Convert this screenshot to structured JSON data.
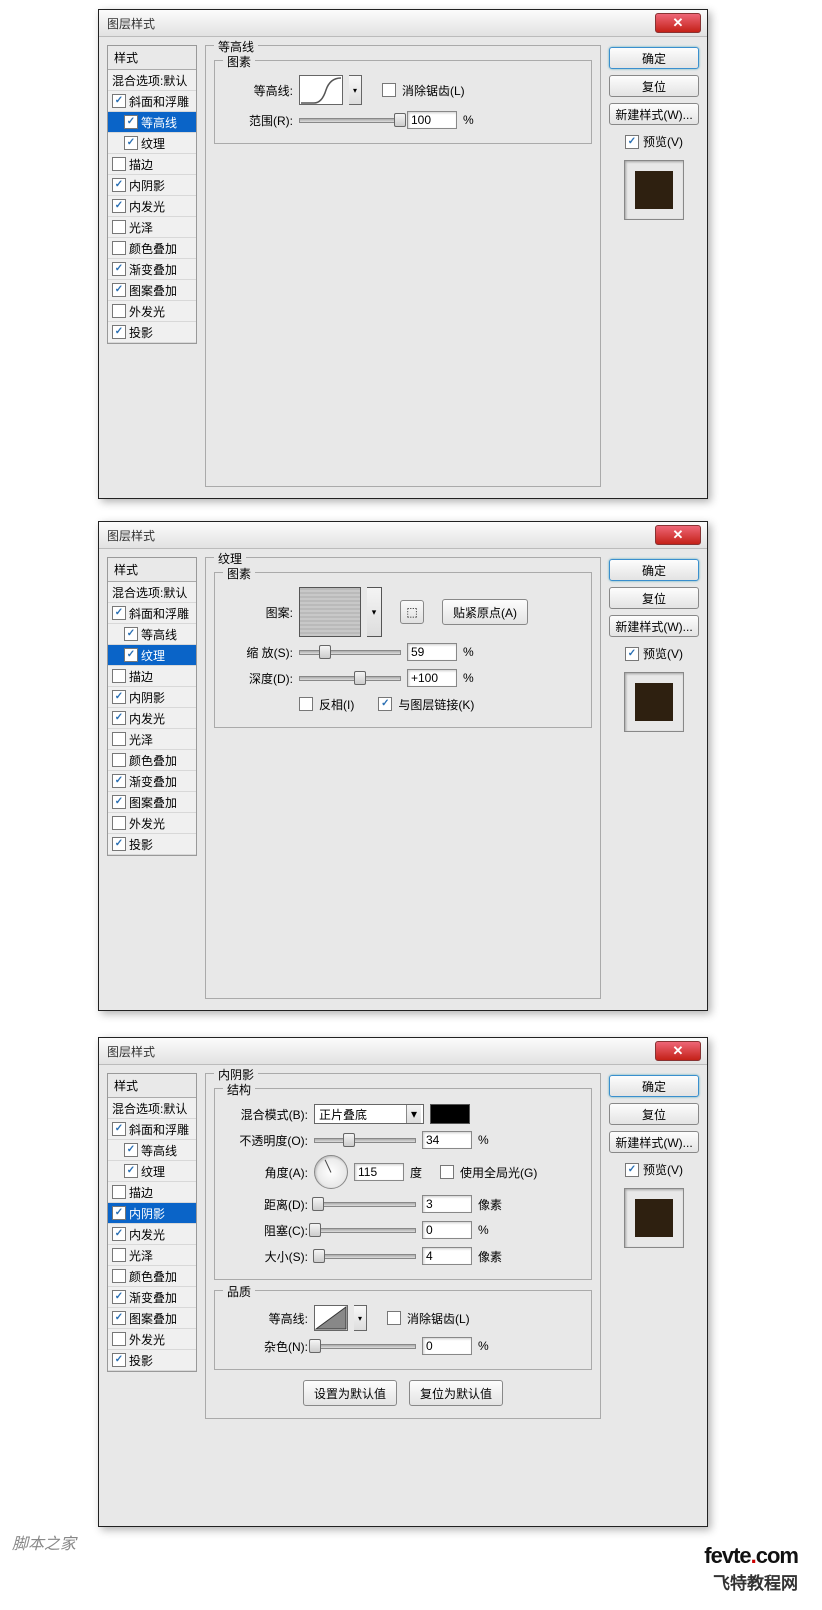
{
  "dialogTitle": "图层样式",
  "buttons": {
    "ok": "确定",
    "reset": "复位",
    "newStyle": "新建样式(W)...",
    "preview": "预览(V)"
  },
  "styles": {
    "header": "样式",
    "blendDefault": "混合选项:默认",
    "bevel": "斜面和浮雕",
    "contour": "等高线",
    "texture": "纹理",
    "stroke": "描边",
    "innerShadow": "内阴影",
    "innerGlow": "内发光",
    "satin": "光泽",
    "colorOverlay": "颜色叠加",
    "gradientOverlay": "渐变叠加",
    "patternOverlay": "图案叠加",
    "outerGlow": "外发光",
    "dropShadow": "投影"
  },
  "panel1": {
    "title": "等高线",
    "sub": "图素",
    "contourLabel": "等高线:",
    "antiAlias": "消除锯齿(L)",
    "rangeLabel": "范围(R):",
    "rangeValue": "100",
    "pct": "%"
  },
  "panel2": {
    "title": "纹理",
    "sub": "图素",
    "patternLabel": "图案:",
    "snap": "贴紧原点(A)",
    "scaleLabel": "缩 放(S):",
    "scaleValue": "59",
    "depthLabel": "深度(D):",
    "depthValue": "+100",
    "invert": "反相(I)",
    "link": "与图层链接(K)",
    "pct": "%"
  },
  "panel3": {
    "title": "内阴影",
    "structTitle": "结构",
    "blendModeLabel": "混合模式(B):",
    "blendModeValue": "正片叠底",
    "opacityLabel": "不透明度(O):",
    "opacityValue": "34",
    "angleLabel": "角度(A):",
    "angleValue": "115",
    "degree": "度",
    "globalLight": "使用全局光(G)",
    "distanceLabel": "距离(D):",
    "distanceValue": "3",
    "chokeLabel": "阻塞(C):",
    "chokeValue": "0",
    "sizeLabel": "大小(S):",
    "sizeValue": "4",
    "px": "像素",
    "qualityTitle": "品质",
    "contourLabel": "等高线:",
    "antiAlias": "消除锯齿(L)",
    "noiseLabel": "杂色(N):",
    "noiseValue": "0",
    "setDefault": "设置为默认值",
    "resetDefault": "复位为默认值",
    "pct": "%"
  },
  "watermark": "脚本之家",
  "logo": {
    "brand": "fevte",
    "dot": ".",
    "tld": "com",
    "sub": "飞特教程网"
  }
}
